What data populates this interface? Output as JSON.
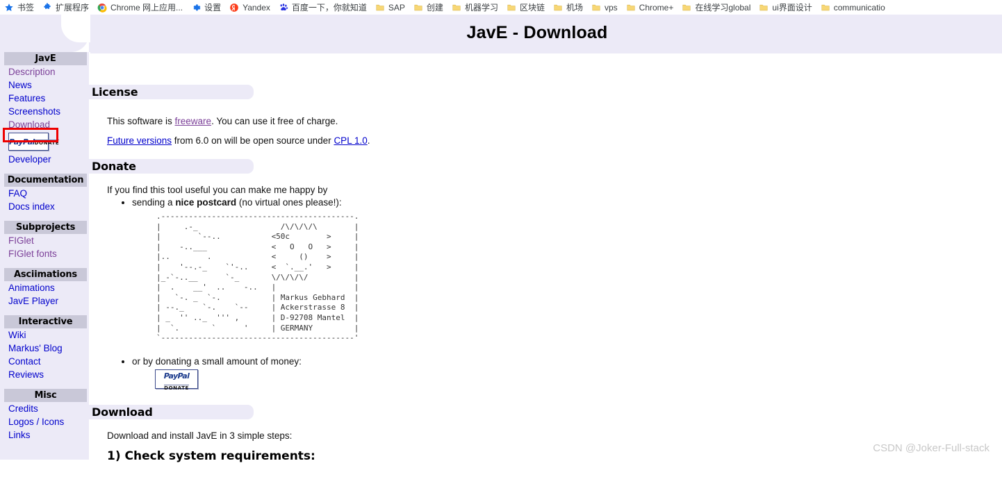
{
  "browser": {
    "bookmarks": [
      {
        "label": "书签",
        "icon": "star-icon"
      },
      {
        "label": "扩展程序",
        "icon": "puzzle-icon"
      },
      {
        "label": "Chrome 网上应用...",
        "icon": "chrome-icon"
      },
      {
        "label": "设置",
        "icon": "gear-icon"
      },
      {
        "label": "Yandex",
        "icon": "yandex-icon"
      },
      {
        "label": "百度一下，你就知道",
        "icon": "baidu-icon"
      },
      {
        "label": "SAP",
        "icon": "folder-icon"
      },
      {
        "label": "创建",
        "icon": "folder-icon"
      },
      {
        "label": "机器学习",
        "icon": "folder-icon"
      },
      {
        "label": "区块链",
        "icon": "folder-icon"
      },
      {
        "label": "机场",
        "icon": "folder-icon"
      },
      {
        "label": "vps",
        "icon": "folder-icon"
      },
      {
        "label": "Chrome+",
        "icon": "folder-icon"
      },
      {
        "label": "在线学习global",
        "icon": "folder-icon"
      },
      {
        "label": "ui界面设计",
        "icon": "folder-icon"
      },
      {
        "label": "communicatio",
        "icon": "folder-icon"
      }
    ]
  },
  "header": {
    "title": "JavE - Download"
  },
  "sidebar": {
    "groups": [
      {
        "heading": "JavE",
        "items": [
          {
            "label": "Description",
            "state": "visited"
          },
          {
            "label": "News",
            "state": "link"
          },
          {
            "label": "Features",
            "state": "link"
          },
          {
            "label": "Screenshots",
            "state": "link"
          },
          {
            "label": "Download",
            "state": "visited",
            "highlighted": true
          },
          {
            "label": "PayPal DONATE",
            "type": "paypal-button"
          },
          {
            "label": "Developer",
            "state": "link"
          }
        ]
      },
      {
        "heading": "Documentation",
        "items": [
          {
            "label": "FAQ",
            "state": "link"
          },
          {
            "label": "Docs index",
            "state": "link"
          }
        ]
      },
      {
        "heading": "Subprojects",
        "items": [
          {
            "label": "FIGlet",
            "state": "visited"
          },
          {
            "label": "FIGlet fonts",
            "state": "visited"
          }
        ]
      },
      {
        "heading": "Asciimations",
        "items": [
          {
            "label": "Animations",
            "state": "link"
          },
          {
            "label": "JavE Player",
            "state": "link"
          }
        ]
      },
      {
        "heading": "Interactive",
        "items": [
          {
            "label": "Wiki",
            "state": "link"
          },
          {
            "label": "Markus' Blog",
            "state": "link"
          },
          {
            "label": "Contact",
            "state": "link"
          },
          {
            "label": "Reviews",
            "state": "link"
          }
        ]
      },
      {
        "heading": "Misc",
        "items": [
          {
            "label": "Credits",
            "state": "link"
          },
          {
            "label": "Logos / Icons",
            "state": "link"
          },
          {
            "label": "Links",
            "state": "link"
          }
        ]
      }
    ]
  },
  "content": {
    "license": {
      "heading": "License",
      "line1_before": "This software is ",
      "line1_link": "freeware",
      "line1_after": ". You can use it free of charge.",
      "line2_link1": "Future versions",
      "line2_mid": " from 6.0 on will be open source under ",
      "line2_link2": "CPL 1.0",
      "line2_end": "."
    },
    "donate": {
      "heading": "Donate",
      "intro": "If you find this tool useful you can make me happy by",
      "bullet1_before": "sending a ",
      "bullet1_bold": "nice postcard",
      "bullet1_after": " (no virtual ones please!):",
      "bullet2": "or by donating a small amount of money:",
      "postcard_ascii": ".------------------------------------------.\n|     .-_                  /\\/\\/\\/\\        |\n|        `--..           <50c        >     |\n|    -..___              <   O   O   >     |\n|..        .             <     ()    >     |\n|    '--.-_    `'-..     <  `.__.'   >     |\n|_-`-..__      `-_       \\/\\/\\/\\/          |\n|  .    __'  ..    -..   |                 |\n|   `-. _  `-.           | Markus Gebhard  |\n| --._    `-.    `--     | Ackerstrasse 8  |\n| _  '' .._  ''' ,       | D-92708 Mantel  |\n|  `.       `      '     | GERMANY         |\n`------------------------------------------'",
      "paypal": {
        "top": "PayPal",
        "bottom": "DONATE"
      }
    },
    "download": {
      "heading": "Download",
      "intro": "Download and install JavE in 3 simple steps:",
      "step1": "1) Check system requirements:"
    }
  },
  "watermark": "CSDN @Joker-Full-stack",
  "colors": {
    "lavender": "#eceaf7",
    "sidebar_head": "#c9c8d8",
    "link": "#0000cc",
    "visited": "#7b3f98",
    "highlight_red": "#ee0000"
  }
}
